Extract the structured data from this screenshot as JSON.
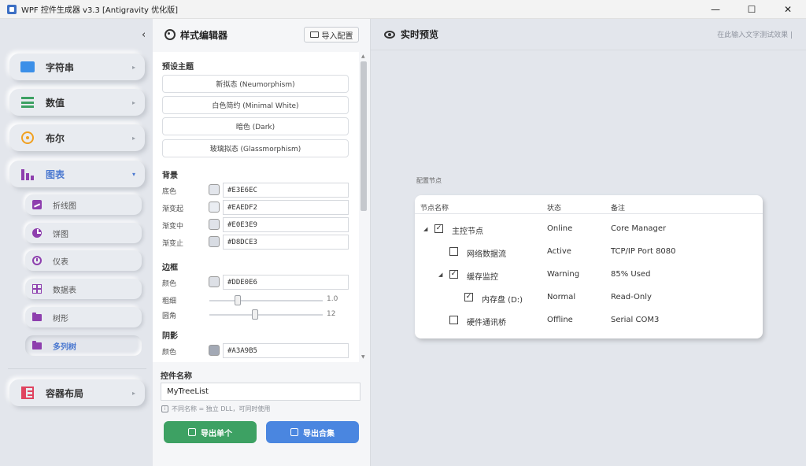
{
  "window": {
    "title": "WPF 控件生成器 v3.3 [Antigravity 优化版]",
    "minimize_glyph": "—",
    "maximize_glyph": "☐",
    "close_glyph": "✕",
    "app_icon": "app-window-icon"
  },
  "sidebar": {
    "collapse_glyph": "‹",
    "items": [
      {
        "label": "字符串",
        "icon": "string-icon",
        "color": "#3B8FE8",
        "arrow": "▸"
      },
      {
        "label": "数值",
        "icon": "list-icon",
        "color": "#3DA163",
        "arrow": "▸"
      },
      {
        "label": "布尔",
        "icon": "toggle-icon",
        "color": "#F0A020",
        "arrow": "▸"
      },
      {
        "label": "图表",
        "icon": "bar-chart-icon",
        "color": "#8E3FAE",
        "arrow": "▾"
      },
      {
        "label": "容器布局",
        "icon": "layout-icon",
        "color": "#E04460",
        "arrow": "▸"
      }
    ],
    "sub_items": [
      {
        "label": "折线图",
        "icon": "line-chart-icon"
      },
      {
        "label": "饼图",
        "icon": "pie-chart-icon"
      },
      {
        "label": "仪表",
        "icon": "gauge-icon"
      },
      {
        "label": "数据表",
        "icon": "table-icon"
      },
      {
        "label": "树形",
        "icon": "folder-icon"
      },
      {
        "label": "多列树",
        "icon": "folder-icon"
      }
    ],
    "sub_icon_color": "#8E3FAE"
  },
  "editor": {
    "title": "样式编辑器",
    "import_label": "导入配置",
    "preset_section": "预设主题",
    "presets": [
      "新拟态 (Neumorphism)",
      "白色简约 (Minimal White)",
      "暗色 (Dark)",
      "玻璃拟态 (Glassmorphism)"
    ],
    "background_section": "背景",
    "background_rows": [
      {
        "label": "底色",
        "value": "#E3E6EC",
        "color": "#E3E6EC"
      },
      {
        "label": "渐变起",
        "value": "#EAEDF2",
        "color": "#EAEDF2"
      },
      {
        "label": "渐变中",
        "value": "#E0E3E9",
        "color": "#E0E3E9"
      },
      {
        "label": "渐变止",
        "value": "#D8DCE3",
        "color": "#D8DCE3"
      }
    ],
    "border_section": "边框",
    "border_color": {
      "label": "颜色",
      "value": "#DDE0E6",
      "color": "#DDE0E6"
    },
    "thickness": {
      "label": "粗细",
      "value": "1.0",
      "level": 0.25
    },
    "radius": {
      "label": "圆角",
      "value": "12",
      "level": 0.4
    },
    "shadow_section": "阴影",
    "shadow_color": {
      "label": "颜色",
      "value": "#A3A9B5",
      "color": "#A3A9B5"
    },
    "control_name_label": "控件名称",
    "control_name_value": "MyTreeList",
    "hint": "不同名称 = 独立 DLL，可同时使用",
    "export_single": "导出单个",
    "export_all": "导出合集",
    "export_single_color": "#3DA163",
    "export_all_color": "#4A86E0"
  },
  "preview": {
    "title": "实时预览",
    "hint": "在此输入文字测试效果 |",
    "config_label": "配置节点",
    "columns": [
      "节点名称",
      "状态",
      "备注"
    ],
    "rows": [
      {
        "level": 0,
        "expander": "◢",
        "checked": true,
        "name": "主控节点",
        "status": "Online",
        "note": "Core Manager"
      },
      {
        "level": 1,
        "expander": "",
        "checked": false,
        "name": "网络数据流",
        "status": "Active",
        "note": "TCP/IP Port 8080"
      },
      {
        "level": 1,
        "expander": "◢",
        "checked": true,
        "name": "缓存监控",
        "status": "Warning",
        "note": "85% Used"
      },
      {
        "level": 2,
        "expander": "",
        "checked": true,
        "name": "内存盘 (D:)",
        "status": "Normal",
        "note": "Read-Only"
      },
      {
        "level": 1,
        "expander": "",
        "checked": false,
        "name": "硬件通讯桥",
        "status": "Offline",
        "note": "Serial COM3"
      }
    ]
  }
}
